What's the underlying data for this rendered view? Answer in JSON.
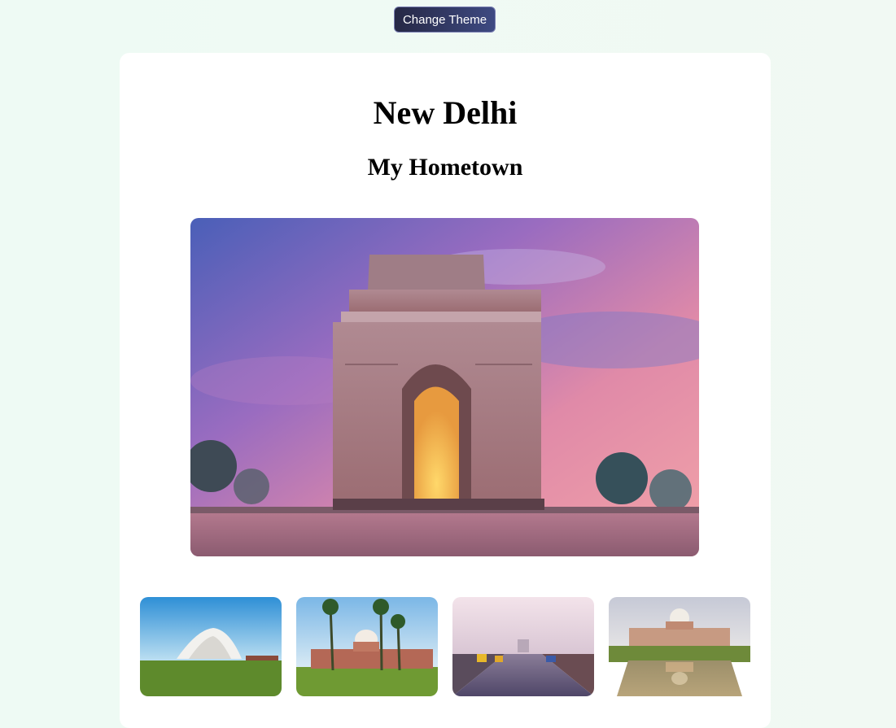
{
  "header": {
    "theme_button_label": "Change Theme"
  },
  "page": {
    "title": "New Delhi",
    "subtitle": "My Hometown"
  },
  "gallery": {
    "thumbnails": [
      {
        "name": "lotus-temple"
      },
      {
        "name": "humayun-tomb"
      },
      {
        "name": "rajpath-street"
      },
      {
        "name": "humayun-tomb-reflection"
      }
    ]
  }
}
